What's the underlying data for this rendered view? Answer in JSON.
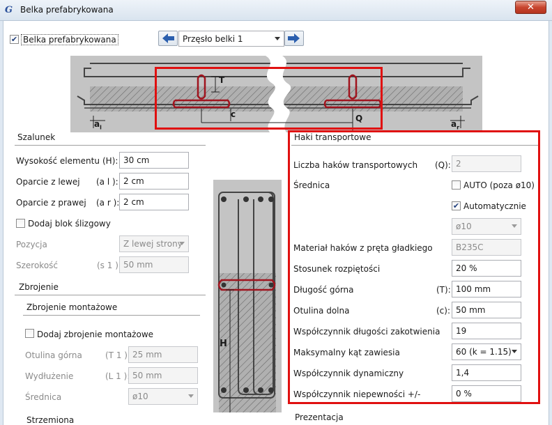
{
  "window": {
    "title": "Belka prefabrykowana",
    "close_label": "✕",
    "icon_glyph": "G"
  },
  "top": {
    "checkbox_label": "Belka prefabrykowana",
    "checkbox_checked": true,
    "span_select": "Przęsło belki 1"
  },
  "diagram_top": {
    "label_T": "T",
    "label_c": "c",
    "label_Q": "Q",
    "label_a_left": "a",
    "label_a_left_sub": "l",
    "label_a_right": "a",
    "label_a_right_sub": "r"
  },
  "szalunek": {
    "title": "Szalunek",
    "rows": [
      {
        "label": "Wysokość elementu",
        "symbol": "(H):",
        "value": "30 cm"
      },
      {
        "label": "Oparcie z lewej",
        "symbol": "(a l ):",
        "value": "2 cm"
      },
      {
        "label": "Oparcie z prawej",
        "symbol": "(a r ):",
        "value": "2 cm"
      }
    ],
    "slide_block_label": "Dodaj blok ślizgowy",
    "position_label": "Pozycja",
    "position_value": "Z lewej strony",
    "width_label": "Szerokość",
    "width_symbol": "(s 1 ):",
    "width_value": "50 mm"
  },
  "zbrojenie": {
    "title": "Zbrojenie",
    "montage_title": "Zbrojenie montażowe",
    "add_montage_label": "Dodaj zbrojenie montażowe",
    "cover_label": "Otulina górna",
    "cover_symbol": "(T 1 ):",
    "cover_value": "25 mm",
    "extension_label": "Wydłużenie",
    "extension_symbol": "(L 1 ):",
    "extension_value": "50 mm",
    "diameter_label": "Średnica",
    "diameter_value": "ø10",
    "stirrups_title": "Strzemiona"
  },
  "diagram_section": {
    "label_H": "H"
  },
  "haki": {
    "title": "Haki transportowe",
    "count_label": "Liczba haków transportowych",
    "count_symbol": "(Q):",
    "count_value": "2",
    "diameter_label": "Średnica",
    "auto_label": "AUTO (poza ø10)",
    "auto_checked": false,
    "automatic_label": "Automatycznie",
    "automatic_checked": true,
    "diameter_value": "ø10",
    "material_label": "Materiał haków z pręta gładkiego",
    "material_value": "B235C",
    "span_ratio_label": "Stosunek rozpiętości",
    "span_ratio_value": "20 %",
    "top_length_label": "Długość górna",
    "top_length_symbol": "(T):",
    "top_length_value": "100 mm",
    "bottom_cover_label": "Otulina dolna",
    "bottom_cover_symbol": "(c):",
    "bottom_cover_value": "50 mm",
    "anchorage_label": "Współczynnik długości zakotwienia",
    "anchorage_value": "19",
    "max_angle_label": "Maksymalny kąt zawiesia",
    "max_angle_value": "60 (k = 1.15)",
    "dynamic_label": "Współczynnik dynamiczny",
    "dynamic_value": "1,4",
    "uncertainty_label": "Współczynnik niepewności +/-",
    "uncertainty_value": "0 %"
  },
  "prezentacja": {
    "title": "Prezentacja"
  },
  "colors": {
    "highlight": "#e01010",
    "rebar": "#a0141e",
    "concrete": "#b8b8b8"
  }
}
